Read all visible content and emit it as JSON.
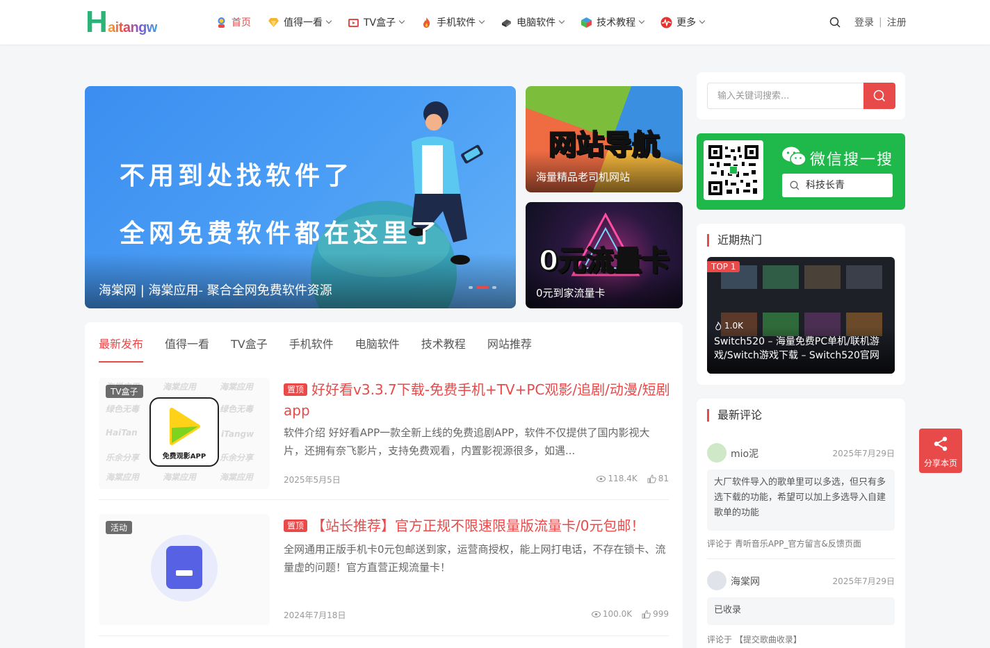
{
  "site": {
    "logo_initial": "H",
    "logo_rest": "aitangw"
  },
  "nav": {
    "items": [
      {
        "label": "首页",
        "icon": "home-icon",
        "dropdown": false,
        "active": true
      },
      {
        "label": "值得一看",
        "icon": "diamond-icon",
        "dropdown": true
      },
      {
        "label": "TV盒子",
        "icon": "tv-icon",
        "dropdown": true
      },
      {
        "label": "手机软件",
        "icon": "fire-icon",
        "dropdown": true
      },
      {
        "label": "电脑软件",
        "icon": "computer-icon",
        "dropdown": true
      },
      {
        "label": "技术教程",
        "icon": "cube-icon",
        "dropdown": true
      },
      {
        "label": "更多",
        "icon": "pulse-icon",
        "dropdown": true
      }
    ],
    "login": "登录",
    "separator": "|",
    "register": "注册"
  },
  "hero": {
    "line1": "不用到处找软件了",
    "line2": "全网免费软件都在这里了",
    "caption": "海棠网 | 海棠应用- 聚合全网免费软件资源"
  },
  "side_cards": [
    {
      "big_text": "网站导航",
      "caption": "海量精品老司机网站"
    },
    {
      "big_text": "0元流量卡",
      "caption": "0元到家流量卡"
    }
  ],
  "tabs": [
    "最新发布",
    "值得一看",
    "TV盒子",
    "手机软件",
    "电脑软件",
    "技术教程",
    "网站推荐"
  ],
  "posts": [
    {
      "category": "TV盒子",
      "pin": "置顶",
      "title": "好好看v3.3.7下载-免费手机+TV+PC观影/追剧/动漫/短剧app",
      "excerpt": "软件介绍 好好看APP一款全新上线的免费追剧APP，软件不仅提供了国内影视大片，还拥有奈飞影片，支持免费观看，内置影视源很多，如遇...",
      "date": "2025年5月5日",
      "views": "118.4K",
      "likes": "81",
      "thumb_label": "免费观影APP",
      "watermarks": [
        "海棠应用",
        "海棠应用",
        "海棠应用",
        "绿色无毒",
        "绿色无毒",
        "HaiTan",
        "iTangw",
        "乐余分享",
        "乐余分享",
        "海棠应用",
        "海棠应用",
        "海棠应用"
      ]
    },
    {
      "category": "活动",
      "pin": "置顶",
      "title": "【站长推荐】官方正规不限速限量版流量卡/0元包邮！",
      "excerpt": "全网通用正版手机卡0元包邮送到家，运营商授权，能上网打电话，不存在锁卡、流量虚的问题！官方直营正规流量卡！",
      "date": "2024年7月18日",
      "views": "100.0K",
      "likes": "999"
    }
  ],
  "sidebar": {
    "search_placeholder": "输入关键词搜索...",
    "wechat_title": "微信搜一搜",
    "wechat_query": "科技长青",
    "hot_title": "近期热门",
    "hot_item": {
      "rank": "TOP 1",
      "likes": "1.0K",
      "title": "Switch520 – 海量免费PC单机/联机游戏/Switch游戏下载 – Switch520官网"
    },
    "comments_title": "最新评论",
    "comments": [
      {
        "user": "mio泥",
        "date": "2025年7月29日",
        "text": "大厂软件导入的歌单里可以多选，但只有多选下载的功能，希望可以加上多选导入自建歌单的功能",
        "ref_prefix": "评论于",
        "ref": "青听音乐APP_官方留言&反馈页面"
      },
      {
        "user": "海棠网",
        "date": "2025年7月29日",
        "text": "已收录",
        "ref_prefix": "评论于",
        "ref": "【提交歌曲收录】"
      }
    ]
  },
  "share": {
    "label": "分享本页"
  },
  "colors": {
    "accent": "#e84a4a",
    "wechat_green": "#1fb84a",
    "logo_green": "#2db37a"
  }
}
